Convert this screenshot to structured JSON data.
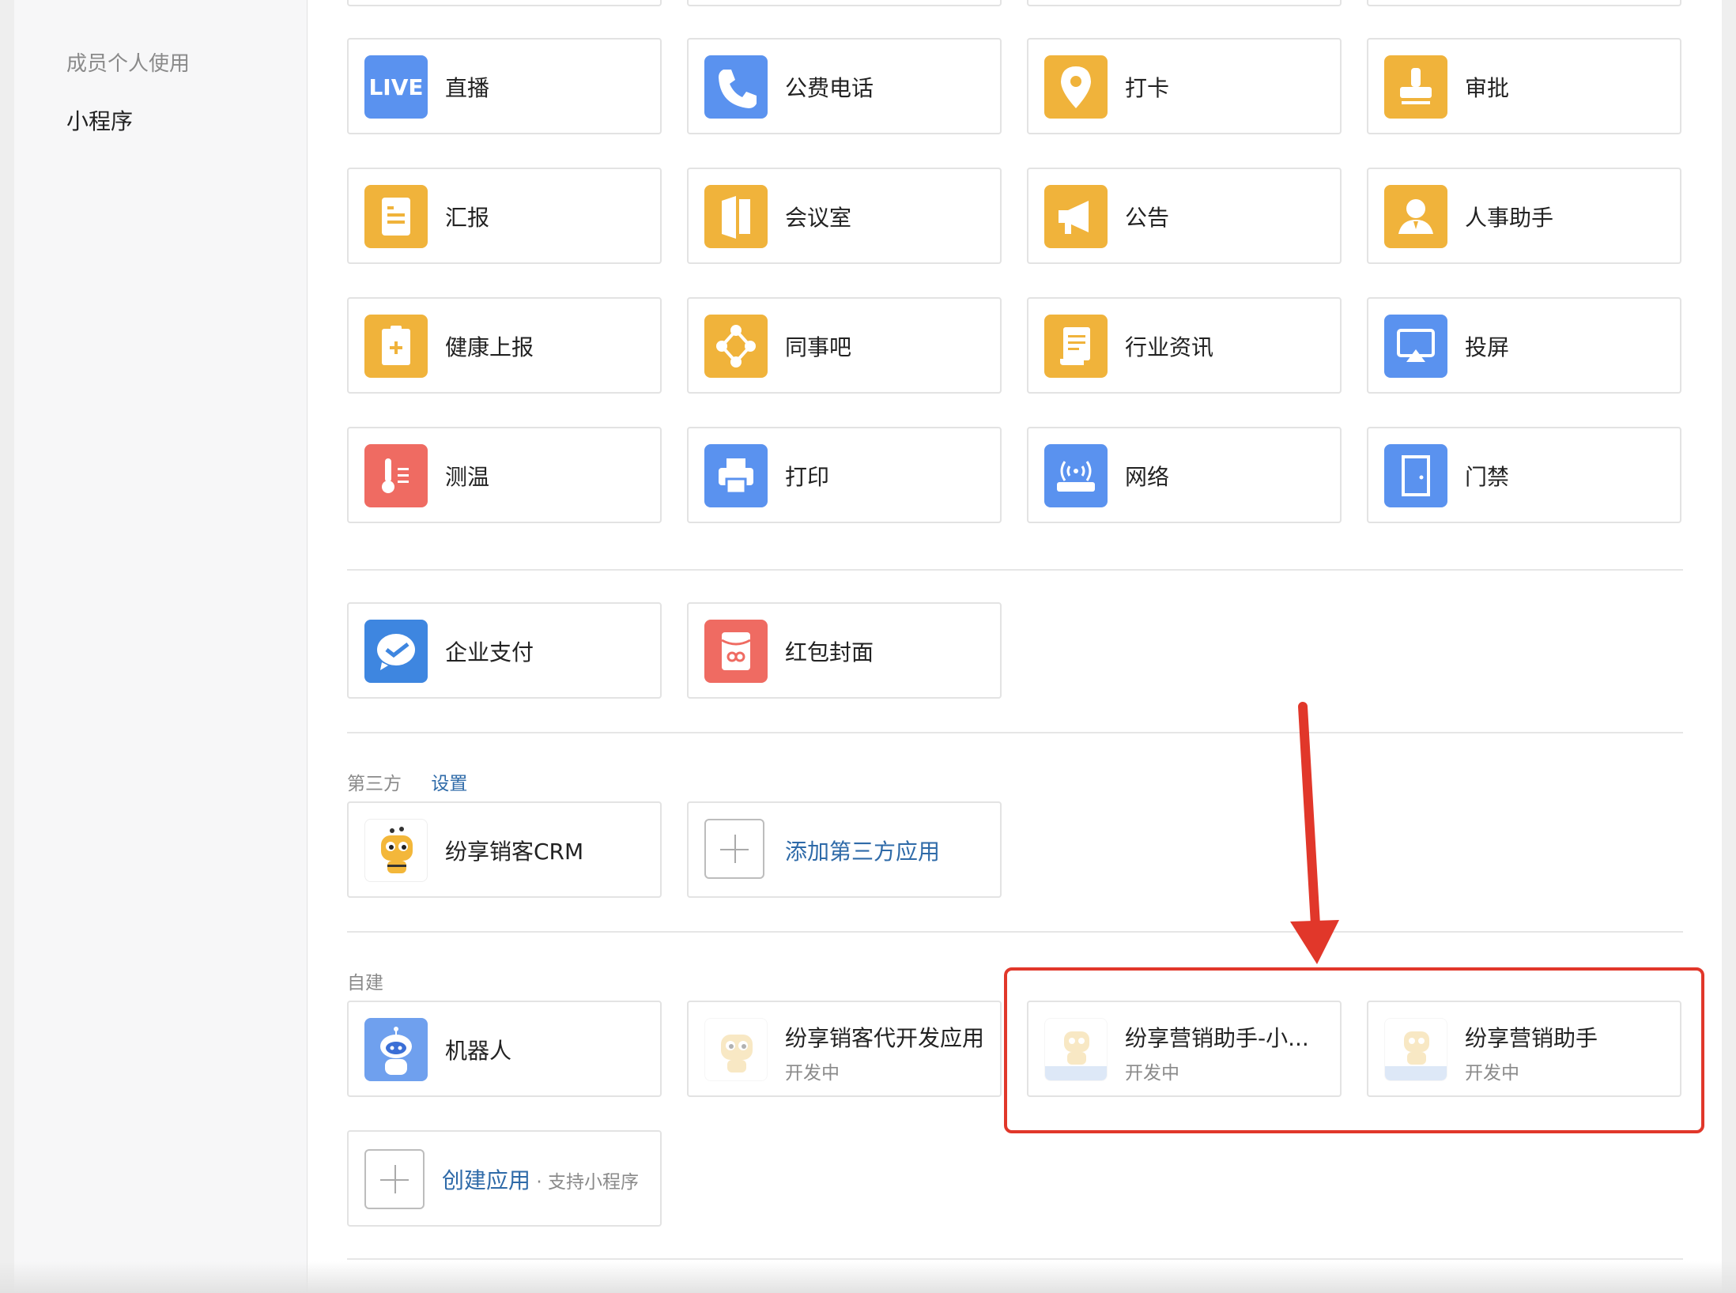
{
  "sidebar": {
    "items": [
      {
        "label": "成员个人使用"
      },
      {
        "label": "小程序"
      }
    ]
  },
  "apps": {
    "row1": [
      {
        "label": "直播",
        "icon": "live-icon"
      },
      {
        "label": "公费电话",
        "icon": "phone-icon"
      },
      {
        "label": "打卡",
        "icon": "location-pin-icon"
      },
      {
        "label": "审批",
        "icon": "stamp-icon"
      }
    ],
    "row2": [
      {
        "label": "汇报",
        "icon": "report-icon"
      },
      {
        "label": "会议室",
        "icon": "door-icon"
      },
      {
        "label": "公告",
        "icon": "megaphone-icon"
      },
      {
        "label": "人事助手",
        "icon": "person-icon"
      }
    ],
    "row3": [
      {
        "label": "健康上报",
        "icon": "clipboard-plus-icon"
      },
      {
        "label": "同事吧",
        "icon": "network-icon"
      },
      {
        "label": "行业资讯",
        "icon": "document-icon"
      },
      {
        "label": "投屏",
        "icon": "airplay-icon"
      }
    ],
    "row4": [
      {
        "label": "测温",
        "icon": "thermometer-icon"
      },
      {
        "label": "打印",
        "icon": "printer-icon"
      },
      {
        "label": "网络",
        "icon": "router-icon"
      },
      {
        "label": "门禁",
        "icon": "access-door-icon"
      }
    ],
    "live_text": "LIVE"
  },
  "payments": [
    {
      "label": "企业支付",
      "icon": "pay-check-icon"
    },
    {
      "label": "红包封面",
      "icon": "red-envelope-icon"
    }
  ],
  "third_party": {
    "section_label": "第三方",
    "settings_link": "设置",
    "apps": [
      {
        "label": "纷享销客CRM",
        "icon": "bee-mascot-icon"
      }
    ],
    "add_label": "添加第三方应用"
  },
  "custom": {
    "section_label": "自建",
    "apps": [
      {
        "label": "机器人",
        "icon": "robot-icon"
      },
      {
        "label": "纷享销客代开发应用",
        "status": "开发中",
        "icon": "bee-mascot-icon"
      },
      {
        "label": "纷享营销助手-小...",
        "status": "开发中",
        "icon": "marketing-bee-icon"
      },
      {
        "label": "纷享营销助手",
        "status": "开发中",
        "icon": "marketing-bee-icon"
      }
    ],
    "create_label": "创建应用",
    "create_sub": " · 支持小程序"
  },
  "colors": {
    "blue": "#5a92ef",
    "yellow": "#f0b33b",
    "red": "#ef6b62",
    "link": "#2e6aa8",
    "highlight": "#e1372a"
  }
}
